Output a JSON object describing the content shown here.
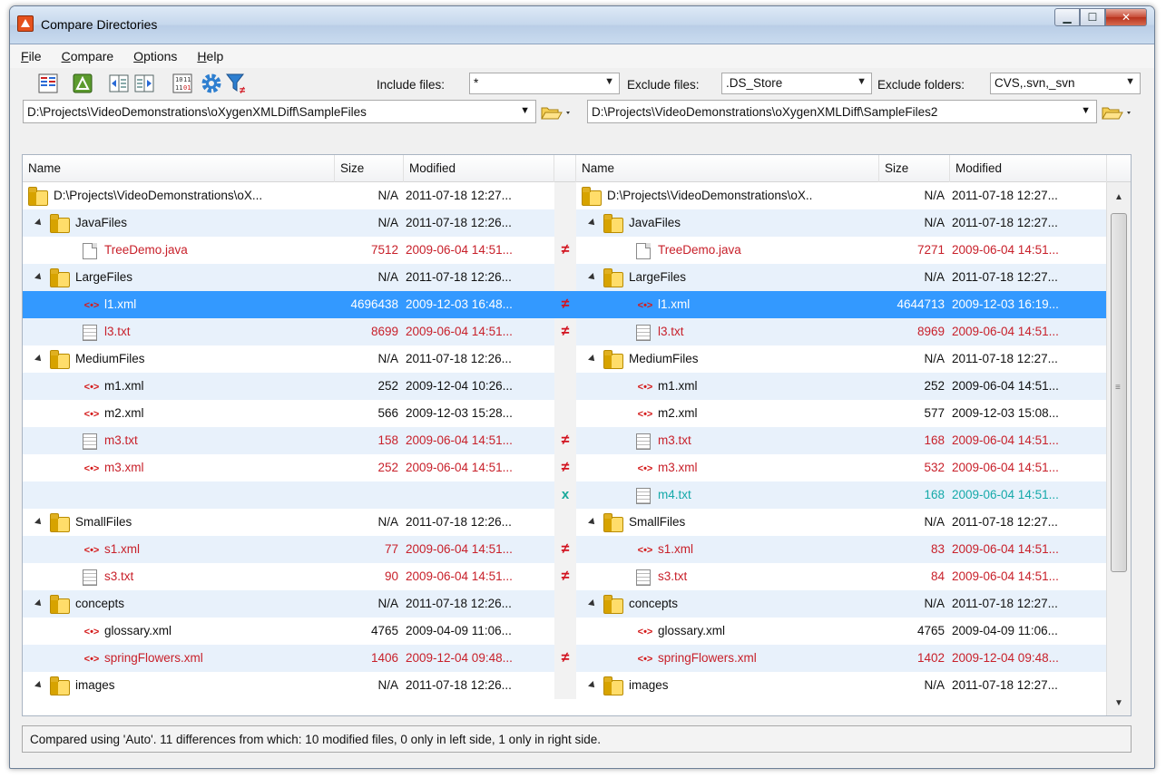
{
  "window": {
    "title": "Compare Directories"
  },
  "menu": [
    "File",
    "Compare",
    "Options",
    "Help"
  ],
  "toolbar": {
    "include_label": "Include files:",
    "include_value": "*",
    "exclude_label": "Exclude files:",
    "exclude_value": ".DS_Store",
    "exclude_folders_label": "Exclude folders:",
    "exclude_folders_value": "CVS,.svn,_svn"
  },
  "paths": {
    "left": "D:\\Projects\\VideoDemonstrations\\oXygenXMLDiff\\SampleFiles",
    "right": "D:\\Projects\\VideoDemonstrations\\oXygenXMLDiff\\SampleFiles2"
  },
  "columns": {
    "name": "Name",
    "size": "Size",
    "modified": "Modified"
  },
  "rows": [
    {
      "type": "root",
      "indent": 0,
      "state": "same",
      "mark": "",
      "left": {
        "name": "D:\\Projects\\VideoDemonstrations\\oX...",
        "size": "N/A",
        "modified": "2011-07-18  12:27..."
      },
      "right": {
        "name": "D:\\Projects\\VideoDemonstrations\\oX..",
        "size": "N/A",
        "modified": "2011-07-18  12:27..."
      }
    },
    {
      "type": "folder",
      "indent": 1,
      "state": "same",
      "mark": "",
      "left": {
        "name": "JavaFiles",
        "size": "N/A",
        "modified": "2011-07-18  12:26..."
      },
      "right": {
        "name": "JavaFiles",
        "size": "N/A",
        "modified": "2011-07-18  12:27..."
      }
    },
    {
      "type": "file",
      "indent": 2,
      "state": "diff",
      "mark": "≠",
      "left": {
        "name": "TreeDemo.java",
        "size": "7512",
        "modified": "2009-06-04  14:51..."
      },
      "right": {
        "name": "TreeDemo.java",
        "size": "7271",
        "modified": "2009-06-04  14:51..."
      }
    },
    {
      "type": "folder",
      "indent": 1,
      "state": "same",
      "mark": "",
      "left": {
        "name": "LargeFiles",
        "size": "N/A",
        "modified": "2011-07-18  12:26..."
      },
      "right": {
        "name": "LargeFiles",
        "size": "N/A",
        "modified": "2011-07-18  12:27..."
      }
    },
    {
      "type": "xml",
      "indent": 2,
      "state": "diff",
      "mark": "≠",
      "selected": true,
      "left": {
        "name": "l1.xml",
        "size": "4696438",
        "modified": "2009-12-03  16:48..."
      },
      "right": {
        "name": "l1.xml",
        "size": "4644713",
        "modified": "2009-12-03  16:19..."
      }
    },
    {
      "type": "txt",
      "indent": 2,
      "state": "diff",
      "mark": "≠",
      "left": {
        "name": "l3.txt",
        "size": "8699",
        "modified": "2009-06-04  14:51..."
      },
      "right": {
        "name": "l3.txt",
        "size": "8969",
        "modified": "2009-06-04  14:51..."
      }
    },
    {
      "type": "folder",
      "indent": 1,
      "state": "same",
      "mark": "",
      "left": {
        "name": "MediumFiles",
        "size": "N/A",
        "modified": "2011-07-18  12:26..."
      },
      "right": {
        "name": "MediumFiles",
        "size": "N/A",
        "modified": "2011-07-18  12:27..."
      }
    },
    {
      "type": "xml",
      "indent": 2,
      "state": "same",
      "mark": "",
      "left": {
        "name": "m1.xml",
        "size": "252",
        "modified": "2009-12-04  10:26..."
      },
      "right": {
        "name": "m1.xml",
        "size": "252",
        "modified": "2009-06-04  14:51..."
      }
    },
    {
      "type": "xml",
      "indent": 2,
      "state": "same",
      "mark": "",
      "left": {
        "name": "m2.xml",
        "size": "566",
        "modified": "2009-12-03  15:28..."
      },
      "right": {
        "name": "m2.xml",
        "size": "577",
        "modified": "2009-12-03  15:08..."
      }
    },
    {
      "type": "txt",
      "indent": 2,
      "state": "diff",
      "mark": "≠",
      "left": {
        "name": "m3.txt",
        "size": "158",
        "modified": "2009-06-04  14:51..."
      },
      "right": {
        "name": "m3.txt",
        "size": "168",
        "modified": "2009-06-04  14:51..."
      }
    },
    {
      "type": "xml",
      "indent": 2,
      "state": "diff",
      "mark": "≠",
      "left": {
        "name": "m3.xml",
        "size": "252",
        "modified": "2009-06-04  14:51..."
      },
      "right": {
        "name": "m3.xml",
        "size": "532",
        "modified": "2009-06-04  14:51..."
      }
    },
    {
      "type": "txt",
      "indent": 2,
      "state": "right-only",
      "mark": "x",
      "left": {
        "name": "",
        "size": "",
        "modified": ""
      },
      "right": {
        "name": "m4.txt",
        "size": "168",
        "modified": "2009-06-04  14:51..."
      }
    },
    {
      "type": "folder",
      "indent": 1,
      "state": "same",
      "mark": "",
      "left": {
        "name": "SmallFiles",
        "size": "N/A",
        "modified": "2011-07-18  12:26..."
      },
      "right": {
        "name": "SmallFiles",
        "size": "N/A",
        "modified": "2011-07-18  12:27..."
      }
    },
    {
      "type": "xml",
      "indent": 2,
      "state": "diff",
      "mark": "≠",
      "left": {
        "name": "s1.xml",
        "size": "77",
        "modified": "2009-06-04  14:51..."
      },
      "right": {
        "name": "s1.xml",
        "size": "83",
        "modified": "2009-06-04  14:51..."
      }
    },
    {
      "type": "txt",
      "indent": 2,
      "state": "diff",
      "mark": "≠",
      "left": {
        "name": "s3.txt",
        "size": "90",
        "modified": "2009-06-04  14:51..."
      },
      "right": {
        "name": "s3.txt",
        "size": "84",
        "modified": "2009-06-04  14:51..."
      }
    },
    {
      "type": "folder",
      "indent": 1,
      "state": "same",
      "mark": "",
      "left": {
        "name": "concepts",
        "size": "N/A",
        "modified": "2011-07-18  12:26..."
      },
      "right": {
        "name": "concepts",
        "size": "N/A",
        "modified": "2011-07-18  12:27..."
      }
    },
    {
      "type": "xml",
      "indent": 2,
      "state": "same",
      "mark": "",
      "left": {
        "name": "glossary.xml",
        "size": "4765",
        "modified": "2009-04-09  11:06..."
      },
      "right": {
        "name": "glossary.xml",
        "size": "4765",
        "modified": "2009-04-09  11:06..."
      }
    },
    {
      "type": "xml",
      "indent": 2,
      "state": "diff",
      "mark": "≠",
      "left": {
        "name": "springFlowers.xml",
        "size": "1406",
        "modified": "2009-12-04  09:48..."
      },
      "right": {
        "name": "springFlowers.xml",
        "size": "1402",
        "modified": "2009-12-04  09:48..."
      }
    },
    {
      "type": "folder",
      "indent": 1,
      "state": "same",
      "mark": "",
      "left": {
        "name": "images",
        "size": "N/A",
        "modified": "2011-07-18  12:26..."
      },
      "right": {
        "name": "images",
        "size": "N/A",
        "modified": "2011-07-18  12:27..."
      }
    }
  ],
  "status": "Compared using 'Auto'. 11 differences from which: 10 modified files, 0 only in left side, 1 only in right side.",
  "colors": {
    "diff": "#c8202a",
    "right_only": "#15a9a9",
    "selection": "#3399ff",
    "alt_row": "#e8f1fb"
  }
}
